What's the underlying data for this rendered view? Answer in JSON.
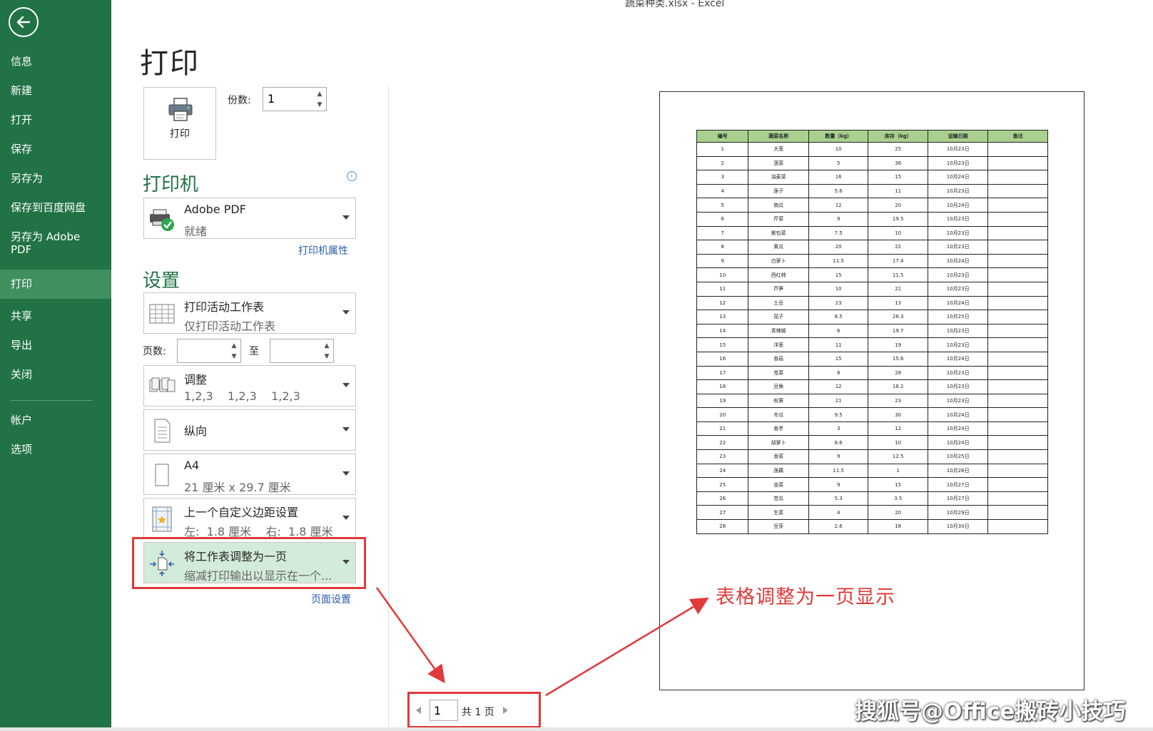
{
  "window_title": "蔬菜种类.xlsx - Excel",
  "nav": {
    "items": [
      {
        "label": "信息",
        "active": false
      },
      {
        "label": "新建",
        "active": false
      },
      {
        "label": "打开",
        "active": false
      },
      {
        "label": "保存",
        "active": false
      },
      {
        "label": "另存为",
        "active": false
      },
      {
        "label": "保存到百度网盘",
        "active": false
      },
      {
        "label": "另存为 Adobe PDF",
        "active": false
      },
      {
        "label": "打印",
        "active": true
      },
      {
        "label": "共享",
        "active": false
      },
      {
        "label": "导出",
        "active": false
      },
      {
        "label": "关闭",
        "active": false
      }
    ],
    "bottom_items": [
      {
        "label": "帐户"
      },
      {
        "label": "选项"
      }
    ]
  },
  "page_title": "打印",
  "print_button_label": "打印",
  "copies": {
    "label": "份数:",
    "value": "1"
  },
  "printer": {
    "section_title": "打印机",
    "name": "Adobe PDF",
    "status": "就绪",
    "properties_link": "打印机属性"
  },
  "settings": {
    "section_title": "设置",
    "what_to_print": {
      "title": "打印活动工作表",
      "subtitle": "仅打印活动工作表"
    },
    "pages_label": "页数:",
    "to_label": "至",
    "collate": {
      "title": "调整",
      "subtitle": "1,2,3    1,2,3    1,2,3"
    },
    "orientation": {
      "title": "纵向"
    },
    "paper": {
      "title": "A4",
      "subtitle": "21 厘米 x 29.7 厘米"
    },
    "margins": {
      "title": "上一个自定义边距设置",
      "subtitle": "左:  1.8 厘米    右:  1.8 厘米"
    },
    "scaling": {
      "title": "将工作表调整为一页",
      "subtitle": "缩减打印输出以显示在一个..."
    },
    "page_setup_link": "页面设置"
  },
  "preview_table": {
    "headers": [
      "编号",
      "蔬菜名称",
      "数量（kg）",
      "库存（kg）",
      "运输日期",
      "备注"
    ],
    "rows": [
      [
        "1",
        "大葱",
        "10",
        "25",
        "10月23日",
        ""
      ],
      [
        "2",
        "菠菜",
        "5",
        "36",
        "10月23日",
        ""
      ],
      [
        "3",
        "油麦菜",
        "16",
        "15",
        "10月24日",
        ""
      ],
      [
        "4",
        "莲子",
        "5.6",
        "11",
        "10月23日",
        ""
      ],
      [
        "5",
        "南瓜",
        "12",
        "20",
        "10月24日",
        ""
      ],
      [
        "6",
        "芹菜",
        "9",
        "19.5",
        "10月23日",
        ""
      ],
      [
        "7",
        "紫包菜",
        "7.5",
        "10",
        "10月23日",
        ""
      ],
      [
        "8",
        "黄瓜",
        "20",
        "22",
        "10月23日",
        ""
      ],
      [
        "9",
        "白萝卜",
        "11.5",
        "17.4",
        "10月24日",
        ""
      ],
      [
        "10",
        "西红柿",
        "15",
        "11.5",
        "10月23日",
        ""
      ],
      [
        "11",
        "芦笋",
        "10",
        "21",
        "10月23日",
        ""
      ],
      [
        "12",
        "土豆",
        "23",
        "13",
        "10月24日",
        ""
      ],
      [
        "13",
        "茄子",
        "8.5",
        "26.3",
        "10月25日",
        ""
      ],
      [
        "14",
        "青辣椒",
        "6",
        "19.7",
        "10月23日",
        ""
      ],
      [
        "15",
        "洋葱",
        "11",
        "19",
        "10月23日",
        ""
      ],
      [
        "16",
        "香菇",
        "15",
        "15.6",
        "10月24日",
        ""
      ],
      [
        "17",
        "苋菜",
        "8",
        "28",
        "10月23日",
        ""
      ],
      [
        "18",
        "豆角",
        "12",
        "18.2",
        "10月23日",
        ""
      ],
      [
        "19",
        "秋葵",
        "21",
        "23",
        "10月23日",
        ""
      ],
      [
        "20",
        "冬瓜",
        "9.5",
        "30",
        "10月24日",
        ""
      ],
      [
        "21",
        "香芋",
        "3",
        "12",
        "10月24日",
        ""
      ],
      [
        "22",
        "胡萝卜",
        "8.6",
        "10",
        "10月24日",
        ""
      ],
      [
        "23",
        "香菜",
        "9",
        "12.5",
        "10月25日",
        ""
      ],
      [
        "24",
        "莲藕",
        "11.5",
        "1",
        "10月26日",
        ""
      ],
      [
        "25",
        "韭菜",
        "9",
        "15",
        "10月27日",
        ""
      ],
      [
        "26",
        "苦瓜",
        "5.3",
        "3.5",
        "10月27日",
        ""
      ],
      [
        "27",
        "生菜",
        "4",
        "20",
        "10月29日",
        ""
      ],
      [
        "28",
        "豆芽",
        "2.6",
        "18",
        "10月30日",
        ""
      ]
    ]
  },
  "pager": {
    "current": "1",
    "total_label": "共 1 页"
  },
  "annotation": "表格调整为一页显示",
  "watermark": "搜狐号@Office搬砖小技巧",
  "colors": {
    "nav_bg": "#217346",
    "accent": "#217346",
    "annotation": "#e03a3a",
    "header_fill": "#a9d08e"
  }
}
